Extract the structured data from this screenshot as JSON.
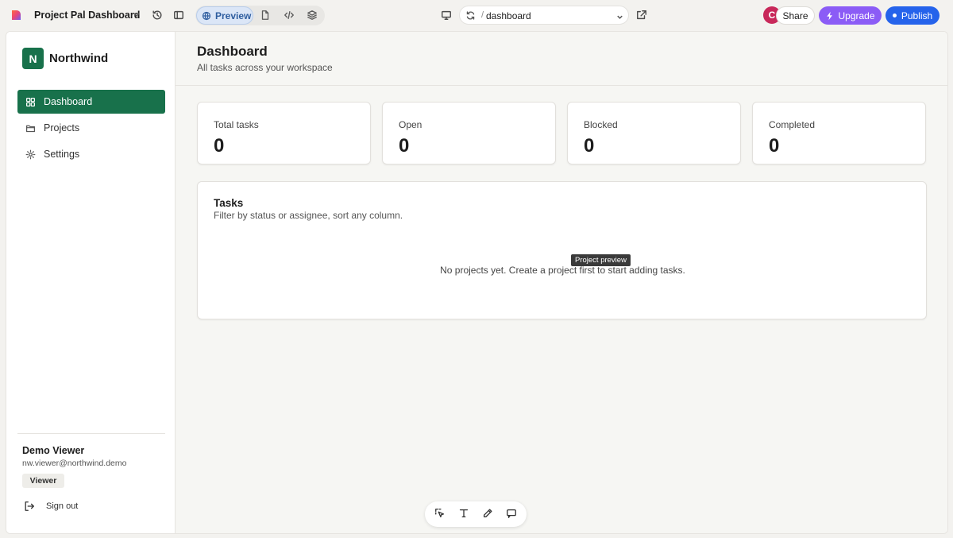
{
  "app": {
    "project_name": "Project Pal Dashboard",
    "preview_label": "Preview",
    "url_path": "dashboard",
    "avatar_initial": "C",
    "share_label": "Share",
    "upgrade_label": "Upgrade",
    "publish_label": "Publish",
    "tooltip": "Project preview",
    "colors": {
      "upgrade": "#8b5cf6",
      "publish": "#2563eb",
      "avatar": "#c8285a"
    }
  },
  "sidebar": {
    "brand_initial": "N",
    "brand_name": "Northwind",
    "items": [
      {
        "label": "Dashboard",
        "icon": "grid-icon",
        "active": true
      },
      {
        "label": "Projects",
        "icon": "folder-icon",
        "active": false
      },
      {
        "label": "Settings",
        "icon": "gear-icon",
        "active": false
      }
    ],
    "user": {
      "name": "Demo Viewer",
      "email": "nw.viewer@northwind.demo",
      "role": "Viewer"
    },
    "sign_out_label": "Sign out",
    "accent": "#18714b"
  },
  "main": {
    "title": "Dashboard",
    "subtitle": "All tasks across your workspace",
    "stats": [
      {
        "label": "Total tasks",
        "value": "0"
      },
      {
        "label": "Open",
        "value": "0"
      },
      {
        "label": "Blocked",
        "value": "0"
      },
      {
        "label": "Completed",
        "value": "0"
      }
    ],
    "tasks": {
      "title": "Tasks",
      "subtitle": "Filter by status or assignee, sort any column.",
      "empty_message": "No projects yet. Create a project first to start adding tasks."
    }
  },
  "dock": {
    "tools": [
      "select-icon",
      "text-icon",
      "pencil-icon",
      "comment-icon"
    ]
  }
}
